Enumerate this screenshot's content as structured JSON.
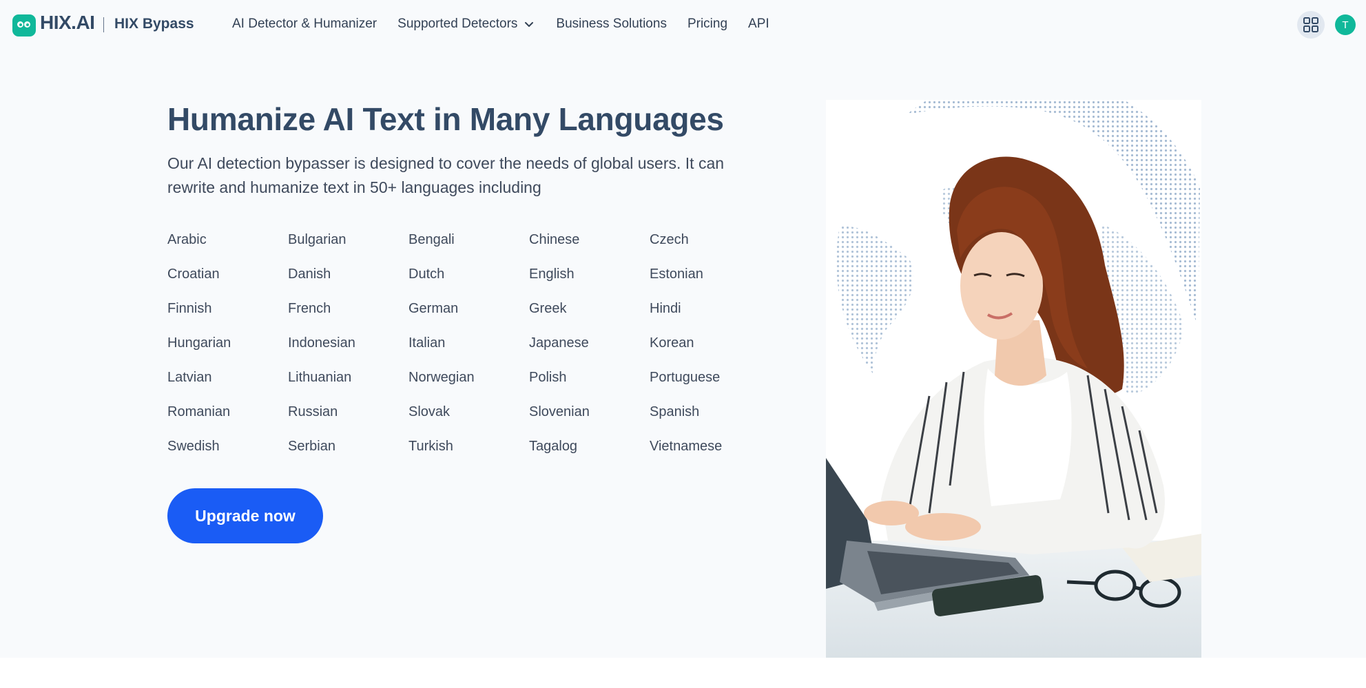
{
  "header": {
    "logo_text": "HIX.AI",
    "product_name": "HIX Bypass",
    "nav": [
      {
        "label": "AI Detector & Humanizer"
      },
      {
        "label": "Supported Detectors",
        "has_dropdown": true
      },
      {
        "label": "Business Solutions"
      },
      {
        "label": "Pricing"
      },
      {
        "label": "API"
      }
    ],
    "avatar_initial": "T"
  },
  "main": {
    "title": "Humanize AI Text in Many Languages",
    "description": "Our AI detection bypasser is designed to cover the needs of global users. It can rewrite and humanize text in 50+ languages including",
    "languages": [
      "Arabic",
      "Bulgarian",
      "Bengali",
      "Chinese",
      "Czech",
      "Croatian",
      "Danish",
      "Dutch",
      "English",
      "Estonian",
      "Finnish",
      "French",
      "German",
      "Greek",
      "Hindi",
      "Hungarian",
      "Indonesian",
      "Italian",
      "Japanese",
      "Korean",
      "Latvian",
      "Lithuanian",
      "Norwegian",
      "Polish",
      "Portuguese",
      "Romanian",
      "Russian",
      "Slovak",
      "Slovenian",
      "Spanish",
      "Swedish",
      "Serbian",
      "Turkish",
      "Tagalog",
      "Vietnamese"
    ],
    "cta_label": "Upgrade now"
  },
  "colors": {
    "brand_green": "#10b89a",
    "cta_blue": "#1a5cf5",
    "heading": "#334a66"
  },
  "icons": [
    "logo-icon",
    "chevron-down-icon",
    "apps-grid-icon"
  ]
}
